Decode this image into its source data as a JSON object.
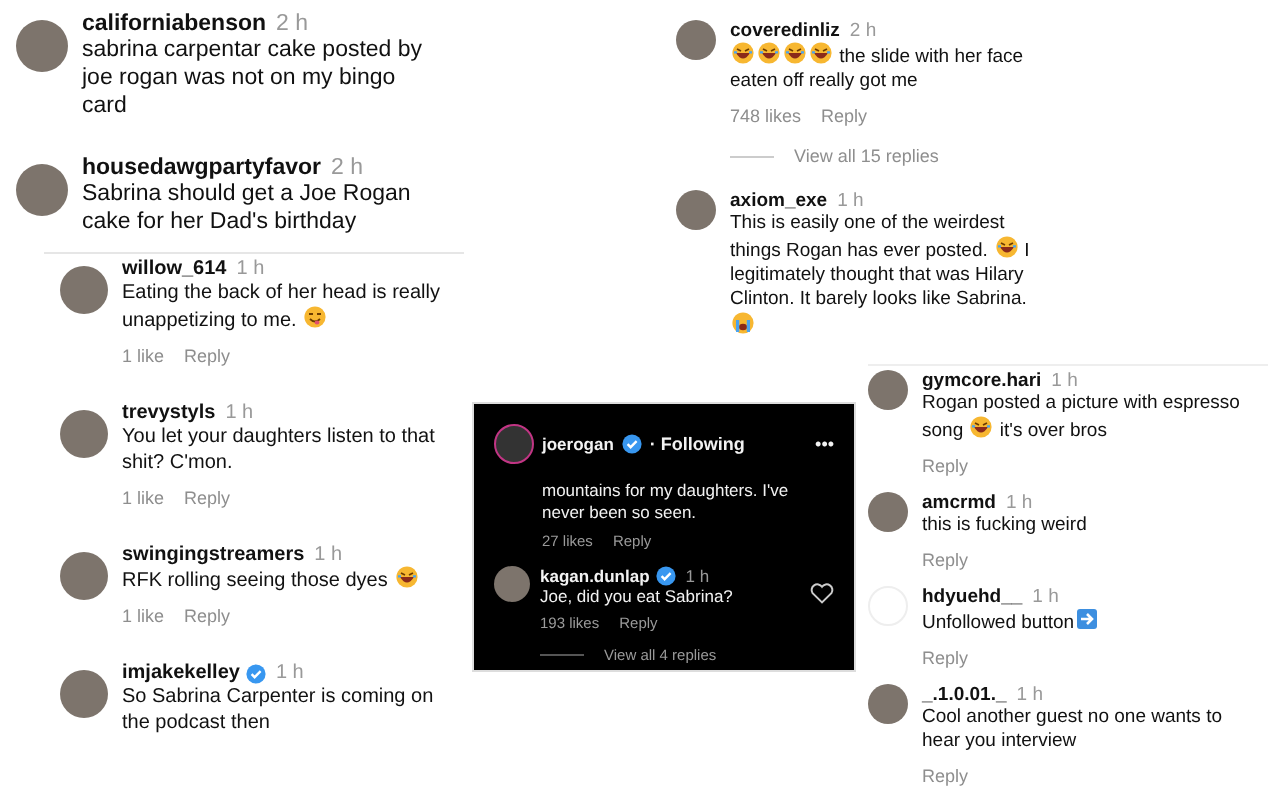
{
  "panels": [
    {
      "kind": "light",
      "comments": [
        {
          "user": "californiabenson",
          "time": "2 h",
          "verified": false,
          "avatar": {
            "kind": "photo"
          },
          "text": [
            {
              "kind": "text",
              "text": "sabrina carpentar cake posted by joe rogan was not on my bingo card"
            }
          ]
        },
        {
          "user": "housedawgpartyfavor",
          "time": "2 h",
          "verified": false,
          "avatar": {
            "kind": "photo"
          },
          "text": [
            {
              "kind": "text",
              "text": "Sabrina should get a Joe Rogan cake for her Dad's birthday"
            }
          ],
          "children": [
            {
              "user": "willow_614",
              "time": "1 h",
              "verified": false,
              "avatar": {
                "kind": "photo"
              },
              "text": [
                {
                  "kind": "text",
                  "text": "Eating the back of her head is really unappetizing to me. "
                },
                {
                  "kind": "yum"
                }
              ],
              "likes": "1 like",
              "reply": "Reply"
            },
            {
              "user": "trevystyls",
              "time": "1 h",
              "verified": false,
              "avatar": {
                "kind": "photo"
              },
              "text": [
                {
                  "kind": "text",
                  "text": "You let your daughters listen to that shit? C'mon."
                }
              ],
              "likes": "1 like",
              "reply": "Reply"
            },
            {
              "user": "swingingstreamers",
              "time": "1 h",
              "verified": false,
              "avatar": {
                "kind": "photo"
              },
              "text": [
                {
                  "kind": "text",
                  "text": "RFK rolling seeing those dyes "
                },
                {
                  "kind": "laugh"
                }
              ],
              "likes": "1 like",
              "reply": "Reply"
            },
            {
              "user": "imjakekelley",
              "time": "1 h",
              "verified": true,
              "avatar": {
                "kind": "photo"
              },
              "text": [
                {
                  "kind": "text",
                  "text": "So Sabrina Carpenter is coming on the podcast then"
                }
              ]
            }
          ]
        }
      ]
    },
    {
      "kind": "light",
      "comments": [
        {
          "user": "coveredinliz",
          "time": "2 h",
          "verified": false,
          "avatar": {
            "kind": "photo"
          },
          "text": [
            {
              "kind": "laugh"
            },
            {
              "kind": "laugh"
            },
            {
              "kind": "laugh"
            },
            {
              "kind": "laugh"
            },
            {
              "kind": "text",
              "text": " the slide with her face eaten off really got me"
            }
          ],
          "likes": "748 likes",
          "reply": "Reply",
          "view_replies": "View all 15 replies"
        },
        {
          "user": "axiom_exe",
          "time": "1 h",
          "verified": false,
          "avatar": {
            "kind": "photo"
          },
          "text": [
            {
              "kind": "text",
              "text": "This is easily one of the weirdest things Rogan has ever posted. "
            },
            {
              "kind": "laugh"
            },
            {
              "kind": "text",
              "text": " I legitimately thought that was Hilary Clinton. It barely looks like Sabrina. "
            },
            {
              "kind": "cry"
            }
          ]
        }
      ]
    },
    {
      "kind": "dark",
      "header": {
        "user": "joerogan",
        "verified": true,
        "follow": "· Following",
        "more": "•••"
      },
      "caption": {
        "text": "mountains for my daughters. I've never been so seen.",
        "likes": "27 likes",
        "reply": "Reply"
      },
      "comments": [
        {
          "user": "kagan.dunlap",
          "time": "1 h",
          "verified": true,
          "avatar": {
            "kind": "photo"
          },
          "heart": true,
          "text": [
            {
              "kind": "text",
              "text": "Joe, did you eat Sabrina?"
            }
          ],
          "likes": "193 likes",
          "reply": "Reply",
          "view_replies": "View all 4 replies"
        }
      ]
    },
    {
      "kind": "light",
      "comments": [
        {
          "user": "gymcore.hari",
          "time": "1 h",
          "verified": false,
          "avatar": {
            "kind": "photo"
          },
          "text": [
            {
              "kind": "text",
              "text": "Rogan posted a picture with espresso song "
            },
            {
              "kind": "laugh"
            },
            {
              "kind": "text",
              "text": " it's over bros"
            }
          ],
          "reply": "Reply"
        },
        {
          "user": "amcrmd",
          "time": "1 h",
          "verified": false,
          "avatar": {
            "kind": "photo"
          },
          "text": [
            {
              "kind": "text",
              "text": "this is fucking weird"
            }
          ],
          "reply": "Reply"
        },
        {
          "user": "hdyuehd__",
          "time": "1 h",
          "verified": false,
          "avatar": {
            "kind": "blank"
          },
          "text": [
            {
              "kind": "text",
              "text": "Unfollowed button"
            },
            {
              "kind": "arrow"
            }
          ],
          "reply": "Reply"
        },
        {
          "user": "_.1.0.01._",
          "time": "1 h",
          "verified": false,
          "avatar": {
            "kind": "photo"
          },
          "text": [
            {
              "kind": "text",
              "text": "Cool another guest no one wants to hear you interview"
            }
          ],
          "reply": "Reply"
        }
      ]
    }
  ]
}
